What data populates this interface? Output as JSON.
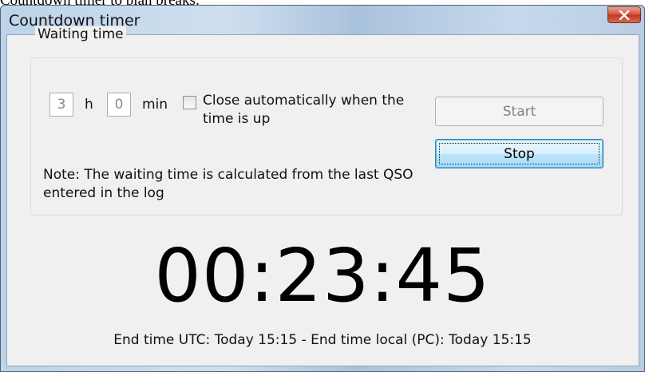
{
  "page": {
    "caption": "Countdown timer to plan breaks:"
  },
  "window": {
    "title": "Countdown timer",
    "close_icon": "close-icon"
  },
  "waiting": {
    "group_title": "Waiting time",
    "hours_value": "3",
    "hours_unit": "h",
    "minutes_value": "0",
    "minutes_unit": "min",
    "auto_close_checked": false,
    "auto_close_label": "Close automatically when the time is up",
    "note": "Note: The waiting time is calculated from the last QSO entered in the log"
  },
  "buttons": {
    "start_label": "Start",
    "start_enabled": false,
    "stop_label": "Stop",
    "stop_focused": true
  },
  "timer": {
    "display": "00:23:45",
    "end_time_text": "End time UTC: Today 15:15 - End time local (PC): Today 15:15"
  },
  "colors": {
    "close_button": "#c1361f",
    "stop_button": "#bee6fd",
    "disabled_text": "#838383"
  }
}
